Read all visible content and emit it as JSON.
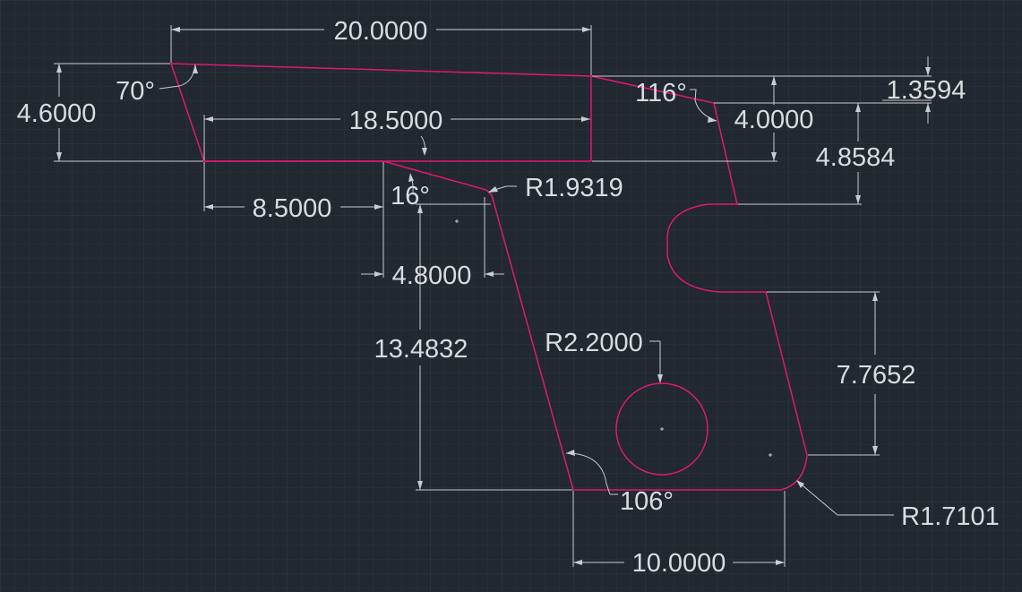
{
  "drawing": {
    "background_color": "#212830",
    "outline_color": "#e0196f",
    "dimension_color": "#d9dcdf"
  },
  "dimensions": {
    "overall_length": "20.0000",
    "left_height": "4.6000",
    "top_angle": "70°",
    "upper_inner_length": "18.5000",
    "barrel_angle": "116°",
    "right_step": "1.3594",
    "barrel_height": "4.0000",
    "slide_to_slot": "4.8584",
    "trigger_offset": "8.5000",
    "trigger_angle": "16°",
    "trigger_radius": "R1.9319",
    "trigger_width": "4.8000",
    "grip_height": "13.4832",
    "hole_radius": "R2.2000",
    "grip_side_height": "7.7652",
    "bottom_angle": "106°",
    "bottom_corner_radius": "R1.7101",
    "bottom_width": "10.0000"
  }
}
